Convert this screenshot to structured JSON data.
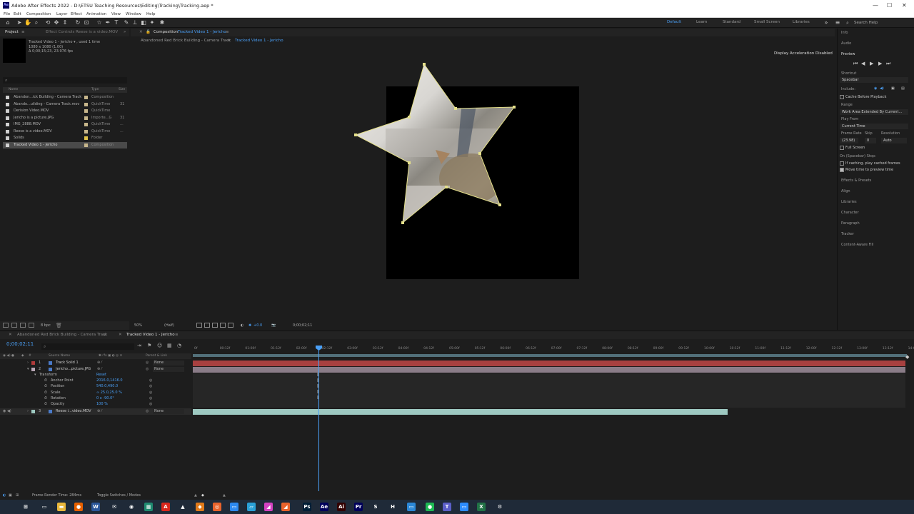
{
  "window": {
    "title": "Adobe After Effects 2022 - D:\\ETSU Teaching Resources\\Editing\\Tracking\\Tracking.aep *",
    "app_icon": "Ae",
    "controls": [
      "—",
      "☐",
      "✕"
    ]
  },
  "menu": [
    "File",
    "Edit",
    "Composition",
    "Layer",
    "Effect",
    "Animation",
    "View",
    "Window",
    "Help"
  ],
  "toolbar": {
    "workspaces": [
      "Default",
      "Learn",
      "Standard",
      "Small Screen",
      "Libraries"
    ],
    "active_workspace": "Default",
    "search_placeholder": "Search Help"
  },
  "project_panel": {
    "tab_label": "Project",
    "effect_controls_tab": "Effect Controls Reese is a video.MOV",
    "selected_info": {
      "name": "Tracked Video 1 - Jericho ▾ , used 1 time",
      "dims": "1080 x 1080 (1.00)",
      "duration": "Δ 0;00;15;23, 23.976 fps"
    },
    "search_placeholder": "⌕",
    "columns": {
      "name": "Name",
      "type": "Type",
      "size": "Size"
    },
    "items": [
      {
        "name": "Abandon...ick Building - Camera Track",
        "type": "Composition",
        "size": "",
        "label_color": "#c7b68b",
        "icon": "comp-icon"
      },
      {
        "name": "Abando...uilding - Camera Track.mov",
        "type": "QuickTime",
        "size": "31",
        "label_color": "#c7b68b",
        "icon": "footage-icon"
      },
      {
        "name": "Derision Video.MOV",
        "type": "QuickTime",
        "size": "",
        "label_color": "#c7b68b",
        "icon": "footage-icon"
      },
      {
        "name": "Jericho is a picture.JPG",
        "type": "Importe...G",
        "size": "31",
        "label_color": "#c7b68b",
        "icon": "image-icon"
      },
      {
        "name": "IMG_2888.MOV",
        "type": "QuickTime",
        "size": "...",
        "label_color": "#c7b68b",
        "icon": "footage-icon"
      },
      {
        "name": "Reese is a video.MOV",
        "type": "QuickTime",
        "size": "...",
        "label_color": "#c7b68b",
        "icon": "footage-icon"
      },
      {
        "name": "Solids",
        "type": "Folder",
        "size": "",
        "label_color": "#e0c24a",
        "icon": "folder-icon"
      },
      {
        "name": "Tracked Video 1 - Jericho",
        "type": "Composition",
        "size": "",
        "label_color": "#c7b68b",
        "icon": "comp-icon",
        "selected": true
      }
    ],
    "bottom_bpc": "8 bpc"
  },
  "composition_panel": {
    "tab_label": "Composition",
    "comp_name": "Tracked Video 1 - Jericho",
    "breadcrumbs": [
      "Abandoned Red Brick Building - Camera Track",
      "Tracked Video 1 - Jericho"
    ],
    "accel_notice": "Display Acceleration Disabled",
    "zoom": "50%",
    "resolution": "(Half)",
    "exposure": "+0.0",
    "timecode": "0;00;02;11"
  },
  "right_panel": {
    "info": "Info",
    "audio": "Audio",
    "preview": "Preview",
    "shortcut_label": "Shortcut",
    "shortcut_value": "Spacebar",
    "include_label": "Include:",
    "cache_before": "Cache Before Playback",
    "range_label": "Range",
    "range_value": "Work Area Extended By Current...",
    "play_from_label": "Play From",
    "play_from_value": "Current Time",
    "frame_rate_label": "Frame Rate",
    "skip_label": "Skip",
    "resolution_label": "Resolution",
    "frame_rate_value": "(23.98)",
    "skip_value": "0",
    "resolution_value": "Auto",
    "full_screen": "Full Screen",
    "on_stop": "On (Spacebar) Stop:",
    "if_caching": "If caching, play cached frames",
    "move_time": "Move time to preview time",
    "panels": [
      "Effects & Presets",
      "Align",
      "Libraries",
      "Character",
      "Paragraph",
      "Tracker",
      "Content-Aware Fill"
    ]
  },
  "timeline": {
    "tabs": [
      "Abandoned Red Brick Building - Camera Track",
      "Tracked Video 1 - Jericho"
    ],
    "timecode": "0;00;02;11",
    "search_placeholder": "⌕",
    "header": {
      "source_name": "Source Name",
      "parent": "Parent & Link"
    },
    "layers": [
      {
        "num": "1",
        "name": "Track Solid 1",
        "parent": "None",
        "color": "#b03a3a",
        "track_color": "#a84040"
      },
      {
        "num": "2",
        "name": "Jericho...picture.JPG",
        "parent": "None",
        "color": "#b9a7b6",
        "track_color": "#8a7c88"
      },
      {
        "num": "3",
        "name": "Reese i...video.MOV",
        "parent": "None",
        "color": "#9ec9c1",
        "track_color": "#9ec9c1"
      }
    ],
    "reset": "Reset",
    "transform": "Transform",
    "props": [
      {
        "name": "Anchor Point",
        "value": "2016.0,1416.0"
      },
      {
        "name": "Position",
        "value": "540.0,490.0"
      },
      {
        "name": "Scale",
        "value": "∞ 25.0,25.0 %"
      },
      {
        "name": "Rotation",
        "value": "0 x -90.0°"
      },
      {
        "name": "Opacity",
        "value": "100 %"
      }
    ],
    "ruler_ticks": [
      "0f",
      "00:12f",
      "01:00f",
      "01:12f",
      "02:00f",
      "02:12f",
      "03:00f",
      "03:12f",
      "04:00f",
      "04:12f",
      "05:00f",
      "05:12f",
      "06:00f",
      "06:12f",
      "07:00f",
      "07:12f",
      "08:00f",
      "08:12f",
      "09:00f",
      "09:12f",
      "10:00f",
      "10:12f",
      "11:00f",
      "11:12f",
      "12:00f",
      "12:12f",
      "13:00f",
      "13:12f",
      "14:0"
    ],
    "playhead_seconds": 2.46,
    "layer3_end_fraction": 0.75,
    "frame_render_time": "Frame Render Time: 284ms",
    "toggle_label": "Toggle Switches / Modes"
  },
  "taskbar": {
    "icons": [
      {
        "name": "start-icon",
        "glyph": "⊞",
        "color": "#1f2a38"
      },
      {
        "name": "task-view-icon",
        "glyph": "▭",
        "color": "#1f2a38"
      },
      {
        "name": "file-explorer-icon",
        "glyph": "▬",
        "color": "#e8b73c"
      },
      {
        "name": "firefox-icon",
        "glyph": "●",
        "color": "#e66000"
      },
      {
        "name": "word-icon",
        "glyph": "W",
        "color": "#2b579a"
      },
      {
        "name": "mail-icon",
        "glyph": "✉",
        "color": "#1f2a38"
      },
      {
        "name": "chrome-icon",
        "glyph": "◉",
        "color": "#1f2a38"
      },
      {
        "name": "sheets-icon",
        "glyph": "▦",
        "color": "#1f8a70"
      },
      {
        "name": "acrobat-icon",
        "glyph": "A",
        "color": "#d9261c"
      },
      {
        "name": "vlc-icon",
        "glyph": "▲",
        "color": "#1f2a38"
      },
      {
        "name": "box-icon",
        "glyph": "◆",
        "color": "#e07a1a"
      },
      {
        "name": "app-icon-1",
        "glyph": "◎",
        "color": "#e8632c"
      },
      {
        "name": "app-icon-2",
        "glyph": "▭",
        "color": "#2d89ef"
      },
      {
        "name": "app-icon-3",
        "glyph": "▱",
        "color": "#2aa1d8"
      },
      {
        "name": "premiere-rush-icon",
        "glyph": "◢",
        "color": "#d442c1"
      },
      {
        "name": "app-icon-4",
        "glyph": "◢",
        "color": "#e8632c"
      },
      {
        "name": "photoshop-icon",
        "glyph": "Ps",
        "color": "#001e36"
      },
      {
        "name": "after-effects-icon",
        "glyph": "Ae",
        "color": "#00005b"
      },
      {
        "name": "illustrator-icon",
        "glyph": "Ai",
        "color": "#330000"
      },
      {
        "name": "premiere-icon",
        "glyph": "Pr",
        "color": "#00005b"
      },
      {
        "name": "app-s-icon",
        "glyph": "S",
        "color": "#1f2a38"
      },
      {
        "name": "app-h-icon",
        "glyph": "H",
        "color": "#1f2a38"
      },
      {
        "name": "app-icon-5",
        "glyph": "▭",
        "color": "#2b88d8"
      },
      {
        "name": "spotify-icon",
        "glyph": "●",
        "color": "#1db954"
      },
      {
        "name": "teams-icon",
        "glyph": "T",
        "color": "#5b5fc7"
      },
      {
        "name": "zoom-icon",
        "glyph": "▭",
        "color": "#2d8cff"
      },
      {
        "name": "excel-icon",
        "glyph": "X",
        "color": "#217346"
      },
      {
        "name": "settings-icon",
        "glyph": "⚙",
        "color": "#1f2a38"
      }
    ]
  }
}
